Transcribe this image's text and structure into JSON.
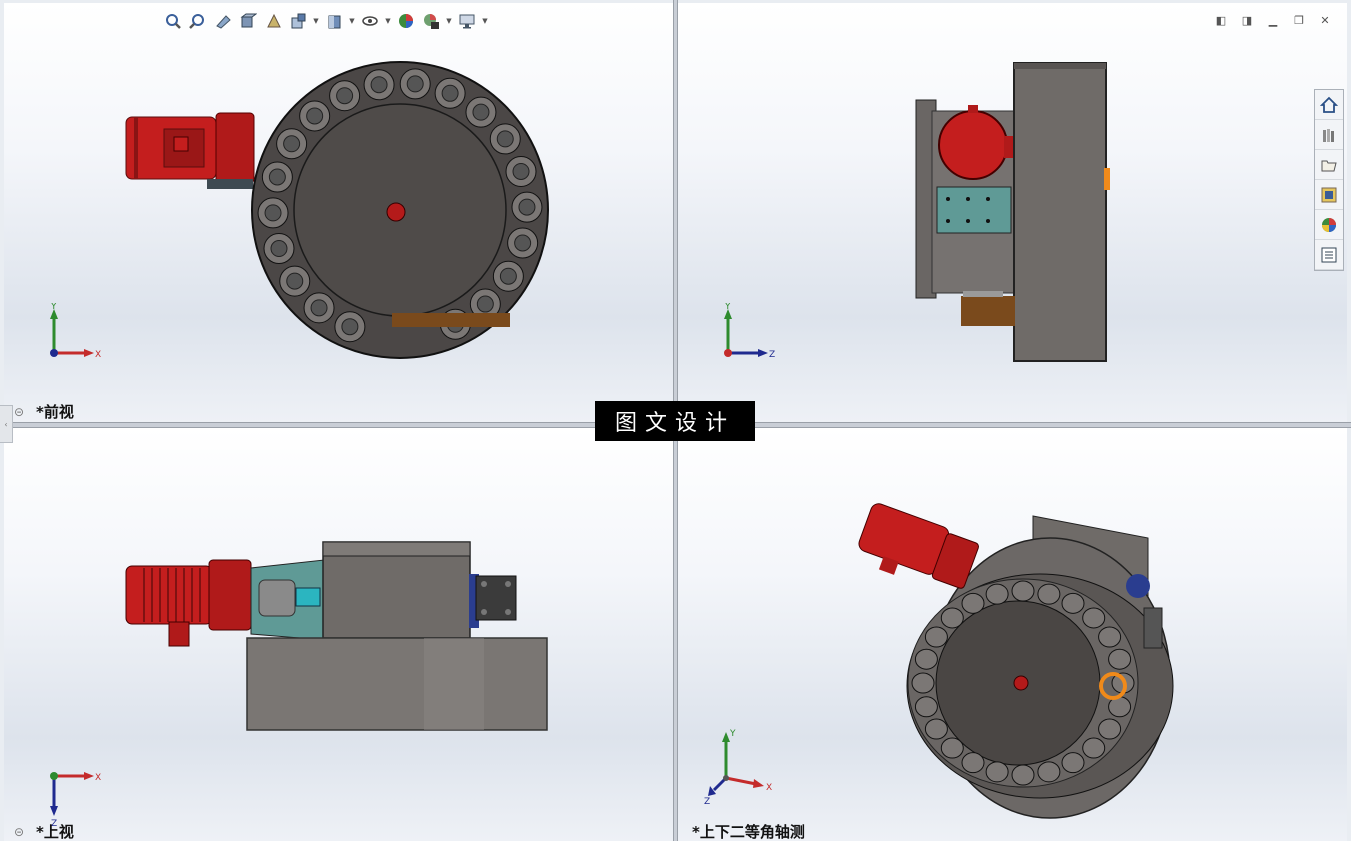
{
  "viewports": {
    "top_left": {
      "label": "*前视",
      "triad": {
        "axis1": "Y",
        "axis2": "X"
      }
    },
    "top_right": {
      "triad": {
        "axis1": "Y",
        "axis2": "Z"
      }
    },
    "bottom_left": {
      "label": "*上视",
      "triad": {
        "axis1": "X",
        "axis2": "Z"
      }
    },
    "bottom_right": {
      "label": "*上下二等角轴测",
      "triad": {
        "axis1": "Y",
        "axis2": "X",
        "axis3": "Z"
      }
    }
  },
  "watermark": "图文设计",
  "toolbar": {
    "buttons": [
      "zoom-to-fit-icon",
      "zoom-to-area-icon",
      "previous-view-icon",
      "section-view-icon",
      "dynamic-annotation-icon",
      "view-orientation-icon",
      "display-style-icon",
      "hide-show-items-icon",
      "edit-appearance-icon",
      "apply-scene-icon",
      "view-settings-icon"
    ]
  },
  "window_controls": [
    "tile-left-icon",
    "tile-right-icon",
    "minimize-icon",
    "restore-icon",
    "close-icon"
  ],
  "task_pane": [
    "home-icon",
    "design-library-icon",
    "file-explorer-icon",
    "view-palette-icon",
    "appearances-icon",
    "custom-properties-icon"
  ],
  "colors": {
    "motor_red": "#c41e1e",
    "housing_gray": "#6f6b66",
    "plate_teal": "#5f9a96",
    "bracket_brown": "#7a4a1c",
    "accent_orange": "#f08a1a"
  }
}
